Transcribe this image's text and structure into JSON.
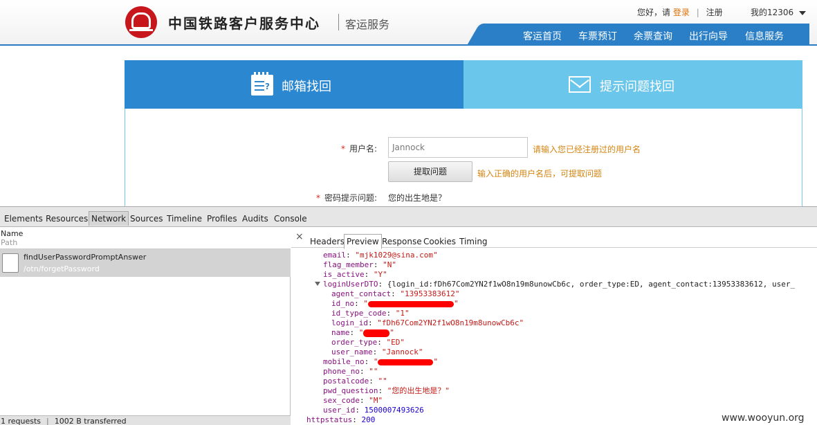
{
  "header": {
    "brand": "中国铁路客户服务中心",
    "brand_sub": "客运服务",
    "greeting": "您好，请",
    "login": "登录",
    "register": "注册",
    "my_account": "我的12306",
    "nav": [
      "客运首页",
      "车票预订",
      "余票查询",
      "出行向导",
      "信息服务"
    ]
  },
  "tabs": {
    "email": "邮箱找回",
    "question": "提示问题找回"
  },
  "form": {
    "username_label": "用户名:",
    "username_value": "Jannock",
    "username_hint": "请输入您已经注册过的用户名",
    "fetch_button": "提取问题",
    "fetch_hint": "输入正确的用户名后，可提取问题",
    "question_label": "密码提示问题:",
    "question_value": "您的出生地是？"
  },
  "devtools": {
    "tabs": [
      "Elements",
      "Resources",
      "Network",
      "Sources",
      "Timeline",
      "Profiles",
      "Audits",
      "Console"
    ],
    "active_tab": "Network",
    "col_name": "Name",
    "col_path": "Path",
    "request": {
      "name": "findUserPasswordPromptAnswer",
      "path": "/otn/forgetPassword"
    },
    "status": {
      "requests": "1 requests",
      "transferred": "1002 B transferred"
    },
    "detail_tabs": [
      "Headers",
      "Preview",
      "Response",
      "Cookies",
      "Timing"
    ],
    "active_detail_tab": "Preview",
    "preview": {
      "email_key": "email",
      "email_val": "\"mjk1029@sina.com\"",
      "flag_member_key": "flag_member",
      "flag_member_val": "\"N\"",
      "is_active_key": "is_active",
      "is_active_val": "\"Y\"",
      "dto_key": "loginUserDTO",
      "dto_summary": "{login_id:fDh67Com2YN2f1wO8n19m8unowCb6c, order_type:ED, agent_contact:13953383612, user_",
      "agent_contact_key": "agent_contact",
      "agent_contact_val": "\"13953383612\"",
      "id_no_key": "id_no",
      "id_type_code_key": "id_type_code",
      "id_type_code_val": "\"1\"",
      "login_id_key": "login_id",
      "login_id_val": "\"fDh67Com2YN2f1wO8n19m8unowCb6c\"",
      "name_key": "name",
      "order_type_key": "order_type",
      "order_type_val": "\"ED\"",
      "user_name_key": "user_name",
      "user_name_val": "\"Jannock\"",
      "mobile_no_key": "mobile_no",
      "phone_no_key": "phone_no",
      "phone_no_val": "\"\"",
      "postalcode_key": "postalcode",
      "postalcode_val": "\"\"",
      "pwd_question_key": "pwd_question",
      "pwd_question_val": "\"您的出生地是？\"",
      "sex_code_key": "sex_code",
      "sex_code_val": "\"M\"",
      "user_id_key": "user_id",
      "user_id_val": "1500007493626",
      "httpstatus_key": "httpstatus",
      "httpstatus_val": "200"
    }
  },
  "watermark": "www.wooyun.org",
  "colors": {
    "brand_red": "#c8161d",
    "nav_blue": "#2b7fc6",
    "tab_email": "#2b87cf",
    "tab_question": "#6ac6ea",
    "hint_orange": "#d58512",
    "redaction": "#ff0000"
  }
}
